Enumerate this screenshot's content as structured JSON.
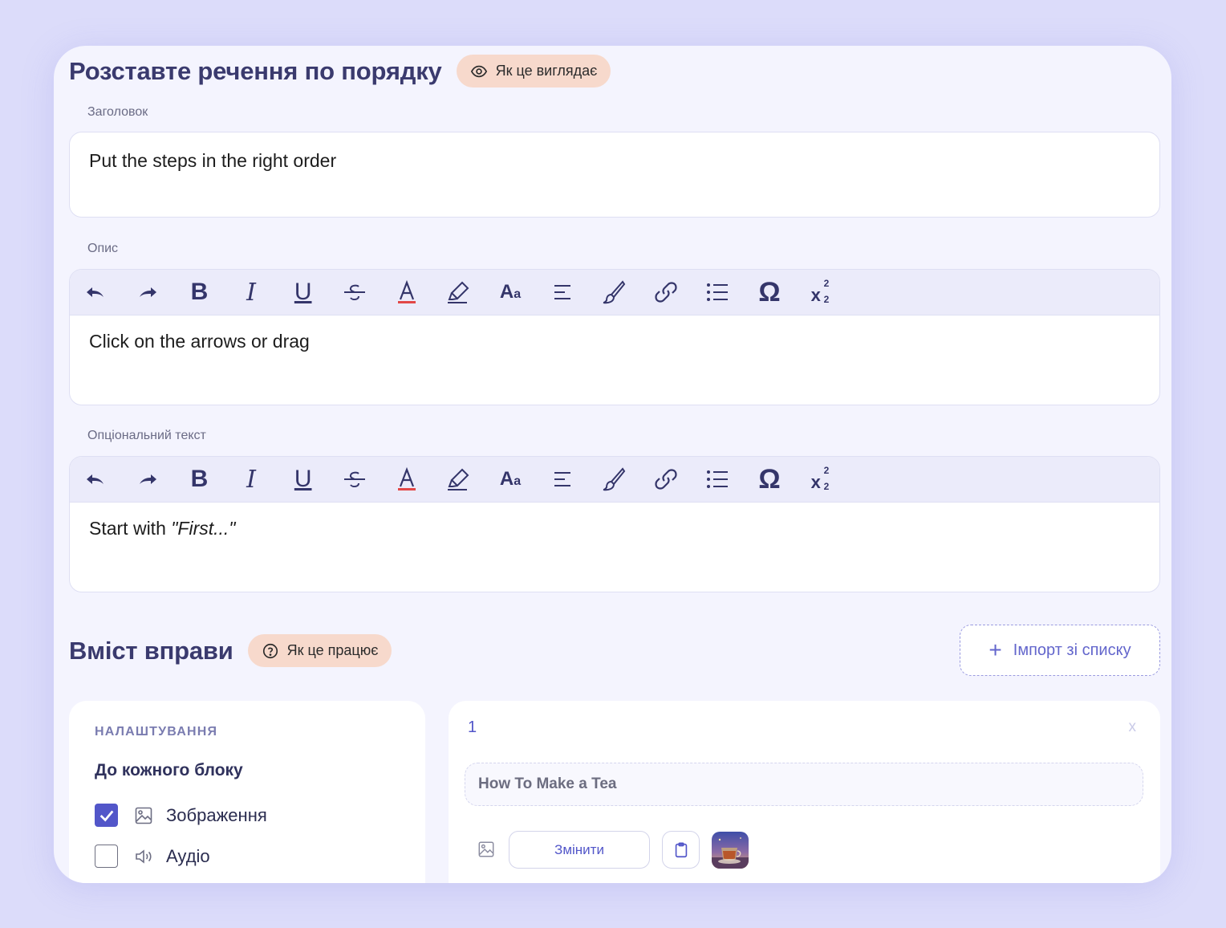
{
  "page": {
    "title": "Розставте речення по порядку",
    "preview_label": "Як це виглядає"
  },
  "heading_field": {
    "label": "Заголовок",
    "value": "Put the steps in the right order"
  },
  "description_field": {
    "label": "Опис",
    "value": "Click on the arrows or drag"
  },
  "optional_field": {
    "label": "Опціональний текст",
    "value_prefix": "Start with ",
    "value_italic": "\"First...\""
  },
  "toolbar": {
    "buttons": [
      "undo-icon",
      "redo-icon",
      "bold-icon",
      "italic-icon",
      "underline-icon",
      "strikethrough-icon",
      "text-color-icon",
      "highlighter-icon",
      "font-size-icon",
      "align-icon",
      "brush-icon",
      "link-icon",
      "list-icon",
      "omega-icon",
      "sub-sup-icon"
    ],
    "bold_glyph": "B",
    "italic_glyph": "I",
    "underline_glyph": "U",
    "color_glyph": "A",
    "fontsize_glyph": "A",
    "fontsize_small": "a",
    "omega_glyph": "Ω",
    "subsup_glyph": "x",
    "sup_digit": "2",
    "sub_digit": "2"
  },
  "content_section": {
    "title": "Вміст вправи",
    "how_label": "Як це працює",
    "import_label": "Імпорт зі списку",
    "import_plus": "+"
  },
  "settings": {
    "heading": "НАЛАШТУВАННЯ",
    "subheading": "До кожного блоку",
    "options": [
      {
        "label": "Зображення",
        "checked": true,
        "icon": "image-icon"
      },
      {
        "label": "Аудіо",
        "checked": false,
        "icon": "audio-icon"
      }
    ]
  },
  "block": {
    "number": "1",
    "close_label": "x",
    "text": "How To Make a Tea",
    "change_label": "Змінити"
  },
  "colors": {
    "accent": "#5256c9",
    "pill_bg": "#f7d9cc",
    "page_bg": "#dcdcfa",
    "card_bg": "#f4f4fe"
  }
}
